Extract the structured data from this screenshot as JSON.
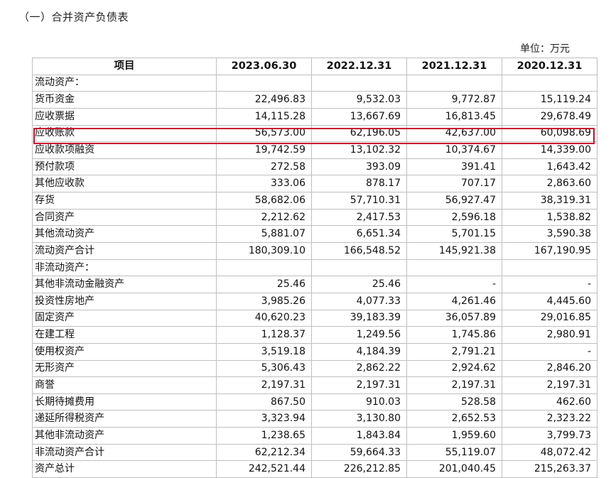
{
  "document": {
    "section_title": "（一）合并资产负债表",
    "unit_label": "单位：万元",
    "highlight_color": "#c8102e"
  },
  "table": {
    "headers": [
      "项目",
      "2023.06.30",
      "2022.12.31",
      "2021.12.31",
      "2020.12.31"
    ],
    "rows": [
      {
        "label": "流动资产：",
        "values": [
          "",
          "",
          "",
          ""
        ]
      },
      {
        "label": "货币资金",
        "values": [
          "22,496.83",
          "9,532.03",
          "9,772.87",
          "15,119.24"
        ]
      },
      {
        "label": "应收票据",
        "values": [
          "14,115.28",
          "13,667.69",
          "16,813.45",
          "29,678.49"
        ]
      },
      {
        "label": "应收账款",
        "values": [
          "56,573.00",
          "62,196.05",
          "42,637.00",
          "60,098.69"
        ]
      },
      {
        "label": "应收款项融资",
        "values": [
          "19,742.59",
          "13,102.32",
          "10,374.67",
          "14,339.00"
        ]
      },
      {
        "label": "预付款项",
        "values": [
          "272.58",
          "393.09",
          "391.41",
          "1,643.42"
        ]
      },
      {
        "label": "其他应收款",
        "values": [
          "333.06",
          "878.17",
          "707.17",
          "2,863.60"
        ]
      },
      {
        "label": "存货",
        "values": [
          "58,682.06",
          "57,710.31",
          "56,927.47",
          "38,319.31"
        ]
      },
      {
        "label": "合同资产",
        "values": [
          "2,212.62",
          "2,417.53",
          "2,596.18",
          "1,538.82"
        ]
      },
      {
        "label": "其他流动资产",
        "values": [
          "5,881.07",
          "6,651.34",
          "5,701.15",
          "3,590.38"
        ]
      },
      {
        "label": "流动资产合计",
        "values": [
          "180,309.10",
          "166,548.52",
          "145,921.38",
          "167,190.95"
        ]
      },
      {
        "label": "非流动资产：",
        "values": [
          "",
          "",
          "",
          ""
        ]
      },
      {
        "label": "其他非流动金融资产",
        "values": [
          "25.46",
          "25.46",
          "-",
          "-"
        ]
      },
      {
        "label": "投资性房地产",
        "values": [
          "3,985.26",
          "4,077.33",
          "4,261.46",
          "4,445.60"
        ]
      },
      {
        "label": "固定资产",
        "values": [
          "40,620.23",
          "39,183.39",
          "36,057.89",
          "29,016.85"
        ]
      },
      {
        "label": "在建工程",
        "values": [
          "1,128.37",
          "1,249.56",
          "1,745.86",
          "2,980.91"
        ]
      },
      {
        "label": "使用权资产",
        "values": [
          "3,519.18",
          "4,184.39",
          "2,791.21",
          "-"
        ]
      },
      {
        "label": "无形资产",
        "values": [
          "5,306.43",
          "2,862.22",
          "2,924.62",
          "2,846.20"
        ]
      },
      {
        "label": "商誉",
        "values": [
          "2,197.31",
          "2,197.31",
          "2,197.31",
          "2,197.31"
        ]
      },
      {
        "label": "长期待摊费用",
        "values": [
          "867.50",
          "910.03",
          "528.58",
          "462.60"
        ]
      },
      {
        "label": "递延所得税资产",
        "values": [
          "3,323.94",
          "3,130.80",
          "2,652.53",
          "2,323.22"
        ]
      },
      {
        "label": "其他非流动资产",
        "values": [
          "1,238.65",
          "1,843.84",
          "1,959.60",
          "3,799.73"
        ]
      },
      {
        "label": "非流动资产合计",
        "values": [
          "62,212.34",
          "59,664.33",
          "55,119.07",
          "48,072.42"
        ]
      },
      {
        "label": "资产总计",
        "values": [
          "242,521.44",
          "226,212.85",
          "201,040.45",
          "215,263.37"
        ]
      }
    ]
  }
}
